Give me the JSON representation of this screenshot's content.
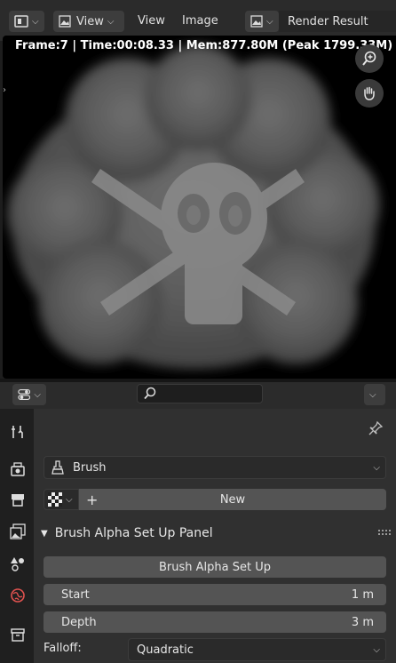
{
  "header": {
    "view_menu_label": "View",
    "view_link": "View",
    "image_link": "Image",
    "image_name": "Render Result"
  },
  "viewport": {
    "overlay_text": "Frame:7 | Time:00:08.33 | Mem:877.80M (Peak 1799.33M)"
  },
  "properties": {
    "search": {
      "value": "",
      "placeholder": ""
    },
    "tabs": [
      "tool",
      "render",
      "output",
      "view-layer",
      "scene",
      "world",
      "collection"
    ],
    "brush": {
      "name": "Brush"
    },
    "texture": {
      "new_label": "New"
    },
    "panel": {
      "title": "Brush Alpha Set Up Panel",
      "setup_button": "Brush Alpha Set Up",
      "start_label": "Start",
      "start_value": "1 m",
      "depth_label": "Depth",
      "depth_value": "3 m",
      "falloff_label": "Falloff:",
      "falloff_value": "Quadratic"
    }
  }
}
